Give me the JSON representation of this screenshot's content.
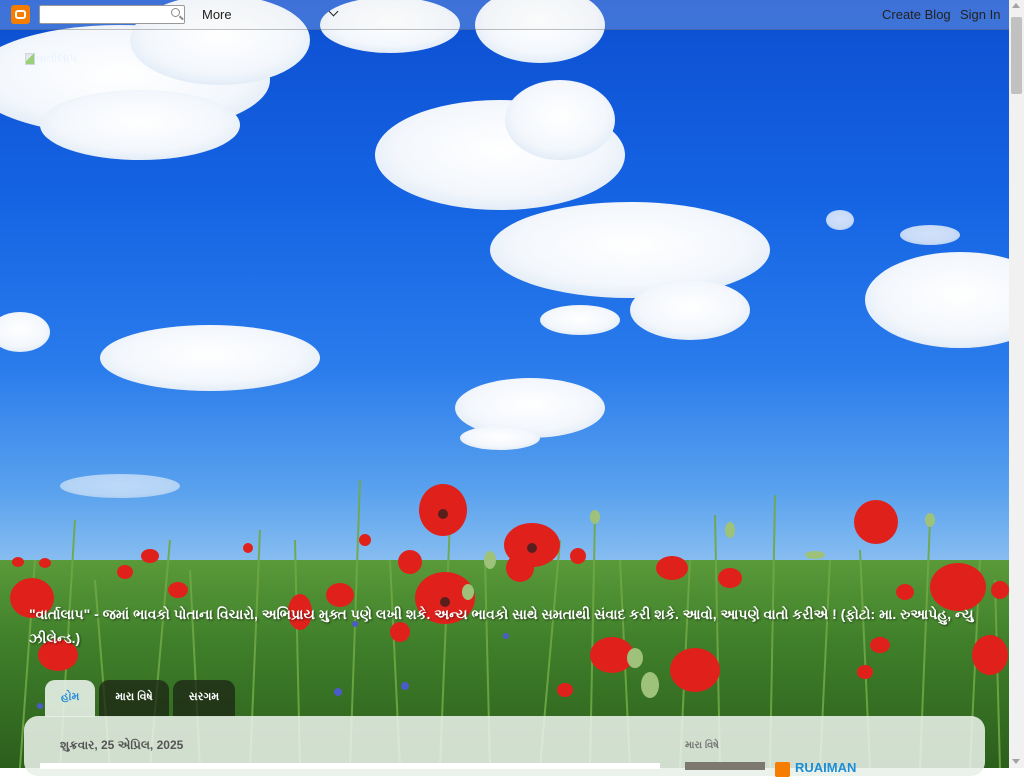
{
  "navbar": {
    "logo_icon": "blogger-icon",
    "search_value": "",
    "more_label": "More",
    "create_blog_label": "Create Blog",
    "sign_in_label": "Sign In"
  },
  "header": {
    "image_alt": "વાર્તાલાપ",
    "description": "\"વાર્તાલાપ\" - જમાં ભાવકો પોતાના વિચારો, અભિપ્રાય મુક્ત પણે લખી શકે. અન્ય ભાવકો સાથે સમતાથી સંવાદ કરી શકે. આવો, આપણે વાતો કરીએ ! (ફોટો: મા. રુઆપેહુ, ન્યુ ઝીલેન્ડ.)"
  },
  "tabs": [
    {
      "label": "હોમ",
      "active": true
    },
    {
      "label": "મારા વિષે",
      "active": false
    },
    {
      "label": "સરગમ",
      "active": false
    }
  ],
  "post": {
    "date_header": "શુક્રવાર, 25 એપ્રિલ, 2025"
  },
  "sidebar": {
    "title": "મારા વિષે",
    "profile_name": "RUAIMAN"
  },
  "colors": {
    "sky_top": "#0d4fd1",
    "poppy_red": "#e0211b",
    "blogger_orange": "#f57d00",
    "link_blue": "#1b8ed6"
  }
}
